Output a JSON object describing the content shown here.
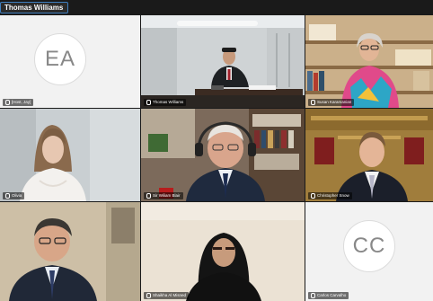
{
  "active_speaker": "Thomas Williams",
  "tiles": [
    {
      "initials": "EA",
      "name": "[Host, Jay]"
    },
    {
      "name": "Thomas Williams"
    },
    {
      "name": "Susan Karamanian"
    },
    {
      "name": "Olivia"
    },
    {
      "name": "Sir Wiliam Blair"
    },
    {
      "name": "Christopher Snow"
    },
    {
      "name": ""
    },
    {
      "name": "Shaikha Al Misned"
    },
    {
      "initials": "CC",
      "name": "Carlos Carvalho"
    }
  ]
}
